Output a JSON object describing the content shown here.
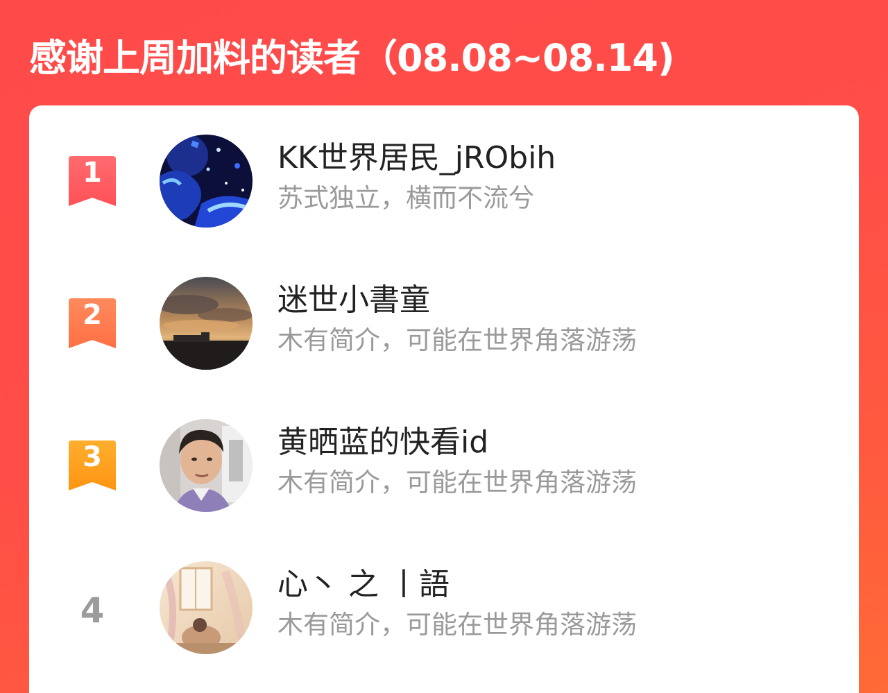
{
  "header": {
    "title": "感谢上周加料的读者（08.08~08.14)"
  },
  "colors": {
    "background_start": "#ff4a4a",
    "background_end": "#ff6a36",
    "rank1": "#ff5a5f",
    "rank2": "#ff7a4d",
    "rank3": "#ff9a1f",
    "rank_plain": "#9b9b9b",
    "name_text": "#222222",
    "bio_text": "#9a9a9a"
  },
  "readers": [
    {
      "rank": "1",
      "rank_icon": "ribbon-badge-icon",
      "avatar_icon": "avatar-starry-night",
      "name": "KK世界居民_jRObih",
      "bio": "苏式独立，横而不流兮"
    },
    {
      "rank": "2",
      "rank_icon": "ribbon-badge-icon",
      "avatar_icon": "avatar-sunset-clouds",
      "name": "迷世小書童",
      "bio": "木有简介，可能在世界角落游荡"
    },
    {
      "rank": "3",
      "rank_icon": "ribbon-badge-icon",
      "avatar_icon": "avatar-portrait",
      "name": "黄晒蓝的快看id",
      "bio": "木有简介，可能在世界角落游荡"
    },
    {
      "rank": "4",
      "avatar_icon": "avatar-illustration",
      "name": "心丶 之 丨語",
      "bio": "木有简介，可能在世界角落游荡"
    }
  ]
}
